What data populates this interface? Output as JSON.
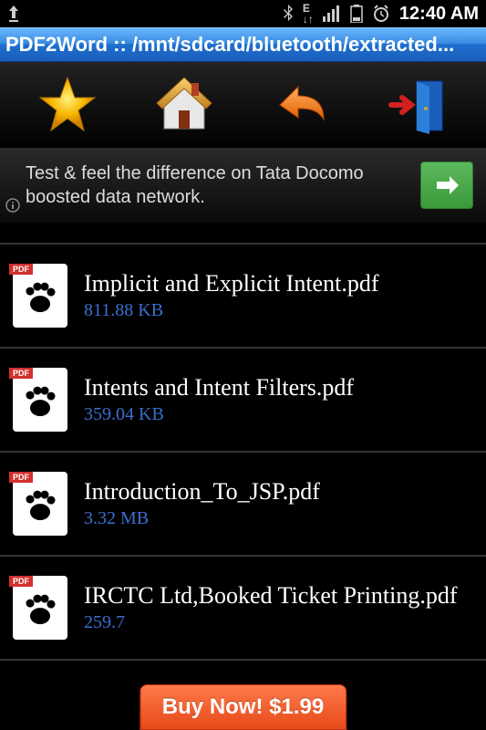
{
  "status": {
    "time": "12:40 AM"
  },
  "title": "PDF2Word :: /mnt/sdcard/bluetooth/extracted...",
  "ad": {
    "text": "Test & feel the difference on Tata Docomo boosted data network."
  },
  "files": [
    {
      "name": "Implicit and Explicit Intent.pdf",
      "size": "811.88 KB"
    },
    {
      "name": "Intents and Intent Filters.pdf",
      "size": "359.04 KB"
    },
    {
      "name": "Introduction_To_JSP.pdf",
      "size": "3.32 MB"
    },
    {
      "name": "IRCTC Ltd,Booked Ticket Printing.pdf",
      "size": "259.7"
    }
  ],
  "buy_label": "Buy Now! $1.99"
}
